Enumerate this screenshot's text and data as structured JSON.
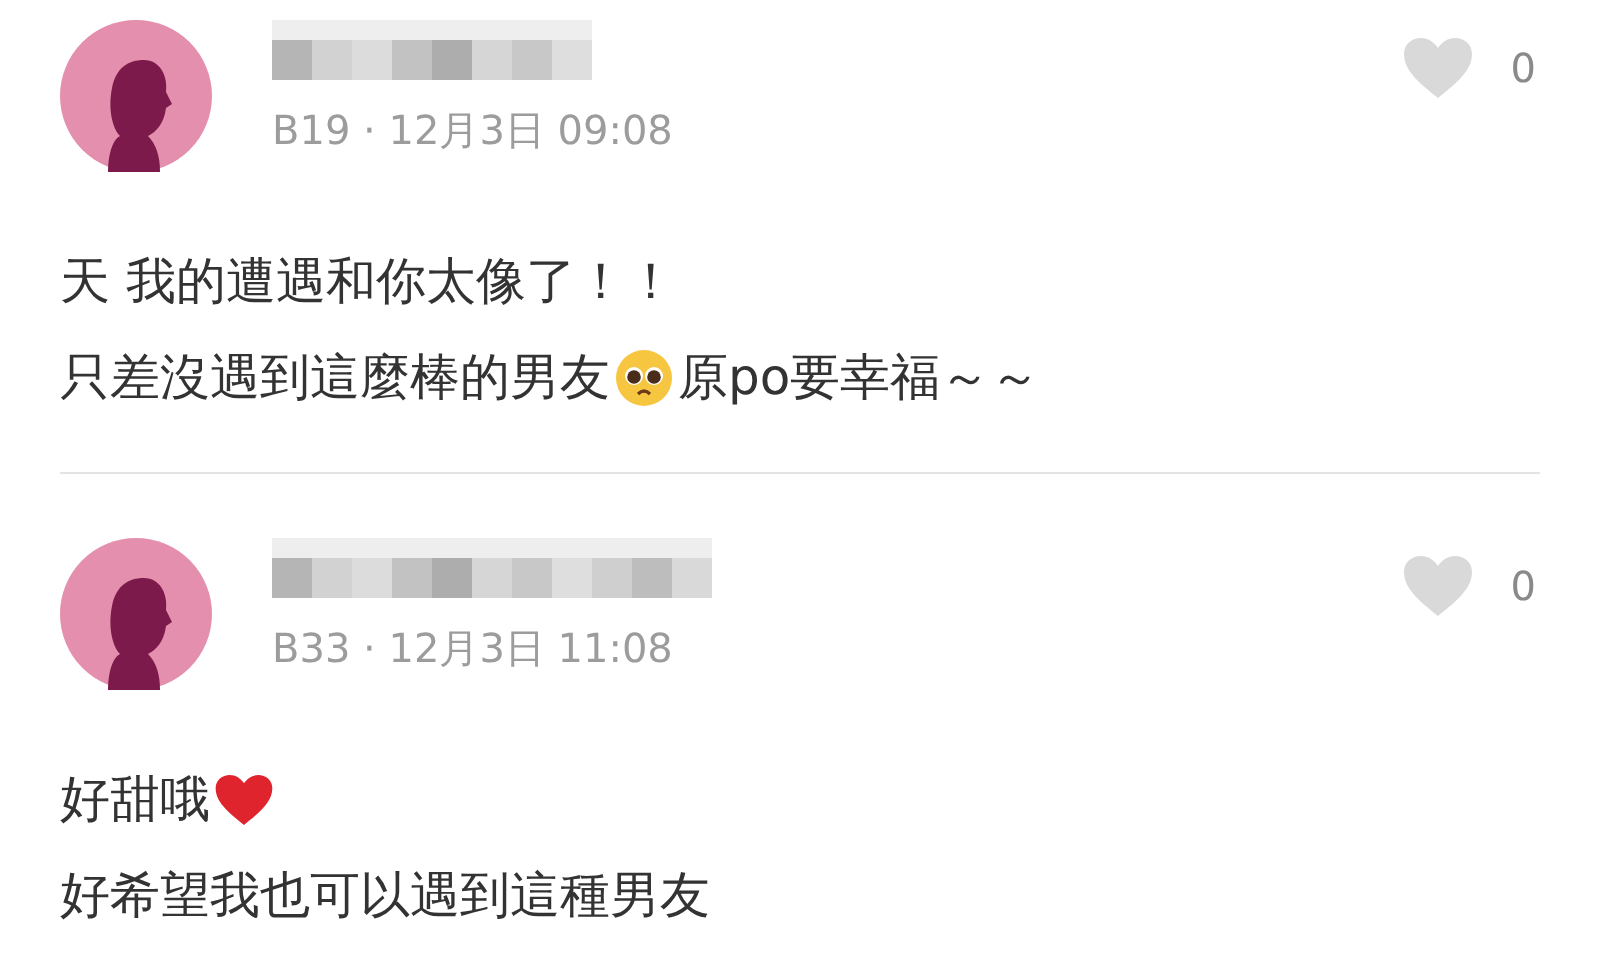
{
  "comments": [
    {
      "meta": "B19 · 12月3日 09:08",
      "likes": "0",
      "lines": [
        [
          {
            "kind": "text",
            "text": "天 我的遭遇和你太像了！！"
          }
        ],
        [
          {
            "kind": "text",
            "text": "只差沒遇到這麼棒的男友"
          },
          {
            "kind": "pleading-emoji"
          },
          {
            "kind": "text",
            "text": "原po要幸福～～"
          }
        ]
      ]
    },
    {
      "meta": "B33 · 12月3日 11:08",
      "likes": "0",
      "lines": [
        [
          {
            "kind": "text",
            "text": "好甜哦"
          },
          {
            "kind": "heart-emoji"
          }
        ],
        [
          {
            "kind": "text",
            "text": "好希望我也可以遇到這種男友"
          }
        ]
      ]
    }
  ]
}
